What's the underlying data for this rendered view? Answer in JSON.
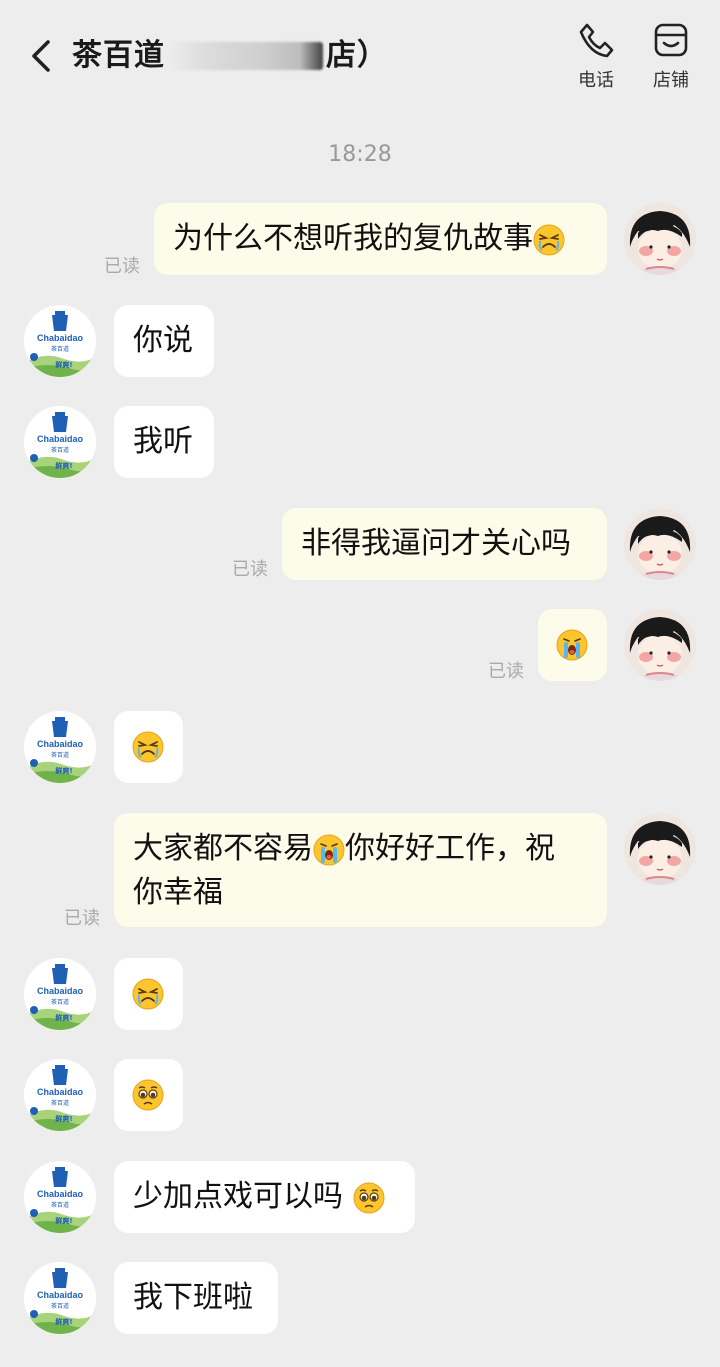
{
  "header": {
    "title_prefix": "茶百道",
    "title_suffix": "店）",
    "phone_label": "电话",
    "store_label": "店铺"
  },
  "timestamp": "18:28",
  "read_label": "已读",
  "shop_logo": {
    "brand": "Chabaidao",
    "brand_cn": "茶百道",
    "slogan": "鲜爽!"
  },
  "messages": [
    {
      "from": "me",
      "text": "为什么不想听我的复仇故事",
      "emoji": "angry-crying"
    },
    {
      "from": "shop",
      "text": "你说"
    },
    {
      "from": "shop",
      "text": "我听"
    },
    {
      "from": "me",
      "text": "非得我逼问才关心吗"
    },
    {
      "from": "me",
      "text": "",
      "emoji": "crying"
    },
    {
      "from": "shop",
      "text": "",
      "emoji": "angry-crying"
    },
    {
      "from": "me",
      "text_line1_a": "大家都不容易",
      "text_line1_b": "你好好工作，祝",
      "text_line2": "你幸福",
      "emoji": "crying"
    },
    {
      "from": "shop",
      "text": "",
      "emoji": "angry-crying"
    },
    {
      "from": "shop",
      "text": "",
      "emoji": "pleading"
    },
    {
      "from": "shop",
      "text": "少加点戏可以吗",
      "emoji": "pleading"
    },
    {
      "from": "shop",
      "text": "我下班啦"
    }
  ],
  "colors": {
    "background": "#ededed",
    "my_bubble": "#fdfbe9",
    "shop_bubble": "#ffffff",
    "brand_blue": "#1f5fb5"
  }
}
